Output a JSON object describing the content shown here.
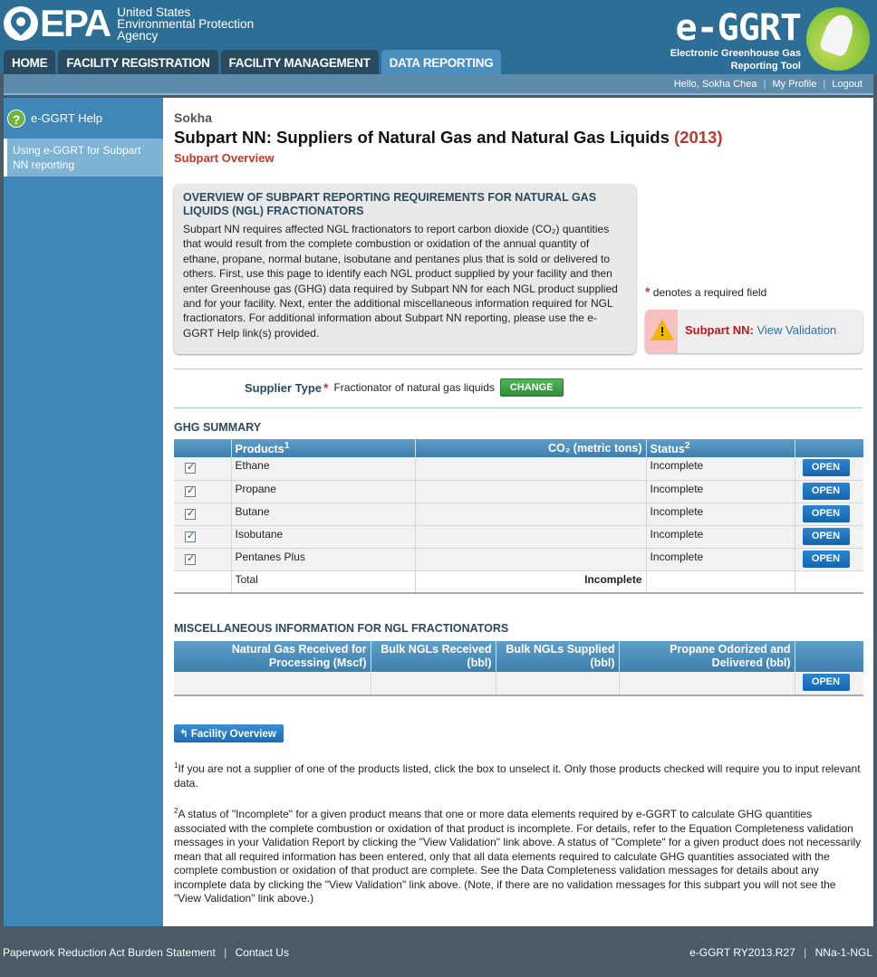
{
  "header": {
    "epa_letters": "EPA",
    "epa_agency_line1": "United States",
    "epa_agency_line2": "Environmental Protection",
    "epa_agency_line3": "Agency",
    "eggrt_title": "e-GGRT",
    "eggrt_sub_line1": "Electronic Greenhouse Gas",
    "eggrt_sub_line2": "Reporting Tool"
  },
  "nav": {
    "tabs": [
      {
        "label": "HOME"
      },
      {
        "label": "FACILITY REGISTRATION"
      },
      {
        "label": "FACILITY MANAGEMENT"
      },
      {
        "label": "DATA REPORTING"
      }
    ],
    "active_index": 3
  },
  "userbar": {
    "greeting": "Hello, Sokha Chea",
    "my_profile": "My Profile",
    "logout": "Logout"
  },
  "sidebar": {
    "help_label": "e-GGRT Help",
    "help_icon": "question-icon",
    "items": [
      {
        "label": "Using e-GGRT for Subpart NN reporting"
      }
    ]
  },
  "main": {
    "user_name": "Sokha",
    "title": "Subpart NN: Suppliers of Natural Gas and Natural Gas Liquids",
    "year": "(2013)",
    "subtitle": "Subpart Overview",
    "overview": {
      "heading": "OVERVIEW OF SUBPART REPORTING REQUIREMENTS FOR NATURAL GAS LIQUIDS (NGL) FRACTIONATORS",
      "body": "Subpart NN requires affected NGL fractionators to report carbon dioxide (CO₂) quantities that would result from the complete combustion or oxidation of the annual quantity of ethane, propane, normal butane, isobutane and pentanes plus that is sold or delivered to others. First, use this page to identify each NGL product supplied by your facility and then enter Greenhouse gas (GHG) data required by Subpart NN for each NGL product supplied and for your facility. Next, enter the additional miscellaneous information required for NGL fractionators. For additional information about Subpart NN reporting, please use the e-GGRT Help link(s) provided."
    },
    "required_note": "denotes a required field",
    "required_star": "*",
    "validation": {
      "label": "Subpart NN:",
      "link": "View Validation",
      "icon": "warning-icon"
    },
    "supplier": {
      "label": "Supplier Type",
      "value": "Fractionator of natural gas liquids",
      "button": "CHANGE"
    },
    "ghg_summary": {
      "heading": "GHG SUMMARY",
      "columns": [
        "Products",
        "CO₂ (metric tons)",
        "Status"
      ],
      "products_sup": "1",
      "status_sup": "2",
      "rows": [
        {
          "product": "Ethane",
          "co2": "",
          "status": "Incomplete",
          "button": "OPEN",
          "checked": true
        },
        {
          "product": "Propane",
          "co2": "",
          "status": "Incomplete",
          "button": "OPEN",
          "checked": true
        },
        {
          "product": "Butane",
          "co2": "",
          "status": "Incomplete",
          "button": "OPEN",
          "checked": true
        },
        {
          "product": "Isobutane",
          "co2": "",
          "status": "Incomplete",
          "button": "OPEN",
          "checked": true
        },
        {
          "product": "Pentanes Plus",
          "co2": "",
          "status": "Incomplete",
          "button": "OPEN",
          "checked": true
        }
      ],
      "total_label": "Total",
      "total_value": "Incomplete"
    },
    "misc": {
      "heading": "MISCELLANEOUS INFORMATION FOR NGL FRACTIONATORS",
      "columns": [
        "Natural Gas Received for Processing (Mscf)",
        "Bulk NGLs Received (bbl)",
        "Bulk NGLs Supplied (bbl)",
        "Propane Odorized and Delivered (bbl)"
      ],
      "button": "OPEN"
    },
    "facility_overview_button": "Facility Overview",
    "footnote1": "If you are not a supplier of one of the products listed, click the box to unselect it. Only those products checked will require you to input relevant data.",
    "footnote2": "A status of \"Incomplete\" for a given product means that one or more data elements required by e-GGRT to calculate GHG quantities associated with the complete combustion or oxidation of that product is incomplete. For details, refer to the Equation Completeness validation messages in your Validation Report by clicking the \"View Validation\" link above. A status of \"Complete\" for a given product does not necessarily mean that all required information has been entered, only that all data elements required to calculate GHG quantities associated with the complete combustion or oxidation of that product are complete. See the Data Completeness validation messages for details about any incomplete data by clicking the \"View Validation\" link above. (Note, if there are no validation messages for this subpart you will not see the \"View Validation\" link above.)",
    "footnote1_mark": "1",
    "footnote2_mark": "2"
  },
  "footer": {
    "paperwork": "Paperwork Reduction Act Burden Statement",
    "contact": "Contact Us",
    "version": "e-GGRT RY2013.R27",
    "page_id": "NNa-1-NGL"
  },
  "colors": {
    "header_blue": "#2d6e96",
    "sidebar_blue": "#3e87b6",
    "title_red": "#c0392b",
    "change_green": "#3a9a40",
    "open_blue": "#1a6dbf"
  }
}
